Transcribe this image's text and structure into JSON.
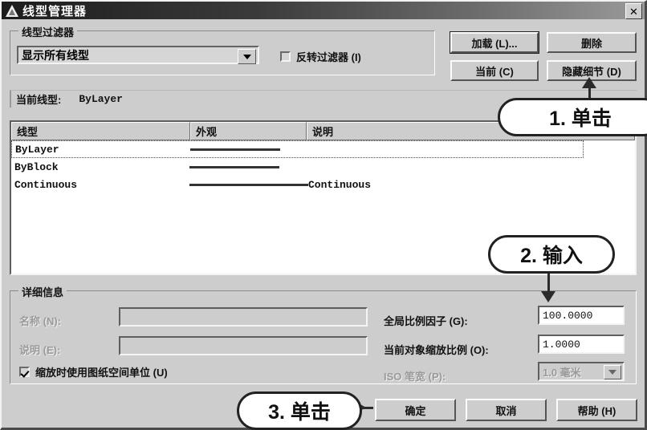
{
  "window": {
    "title": "线型管理器",
    "icon": "autocad-triangle-icon",
    "close_label": "✕"
  },
  "filter": {
    "group_title": "线型过滤器",
    "selected": "显示所有线型",
    "dropdown_icon": "chevron-down-icon",
    "invert_label": "反转过滤器 (I)",
    "invert_checked": false
  },
  "buttons": {
    "load": "加载 (L)...",
    "delete": "删除",
    "current": "当前 (C)",
    "hide_detail": "隐藏细节 (D)"
  },
  "current_linetype": {
    "label": "当前线型:",
    "value": "ByLayer"
  },
  "list": {
    "columns": [
      "线型",
      "外观",
      "说明"
    ],
    "rows": [
      {
        "name": "ByLayer",
        "appearance": "solid-line",
        "appearance_width": 112,
        "description": "",
        "selected": true
      },
      {
        "name": "ByBlock",
        "appearance": "solid-line",
        "appearance_width": 112,
        "description": "",
        "selected": false
      },
      {
        "name": "Continuous",
        "appearance": "solid-line",
        "appearance_width": 158,
        "description": "Continuous",
        "selected": false
      }
    ]
  },
  "details": {
    "group_title": "详细信息",
    "name_label": "名称 (N):",
    "name_value": "",
    "desc_label": "说明 (E):",
    "desc_value": "",
    "paper_space_label": "缩放时使用图纸空间单位 (U)",
    "paper_space_checked": true,
    "global_scale_label": "全局比例因子 (G):",
    "global_scale_value": "100.0000",
    "object_scale_label": "当前对象缩放比例 (O):",
    "object_scale_value": "1.0000",
    "iso_pen_label": "ISO 笔宽 (P):",
    "iso_pen_value": "1.0 毫米",
    "iso_pen_icon": "chevron-down-icon"
  },
  "footer": {
    "ok": "确定",
    "cancel": "取消",
    "help": "帮助 (H)"
  },
  "annotations": {
    "step1": "1. 单击",
    "step2": "2. 输入",
    "step3": "3. 单击"
  },
  "colors": {
    "dialog_face": "#cdcdcd",
    "titlebar_dark": "#1c1c1c",
    "list_background": "#ffffff",
    "annotation_outline": "#222222",
    "disabled_text": "#9a9a9a"
  }
}
